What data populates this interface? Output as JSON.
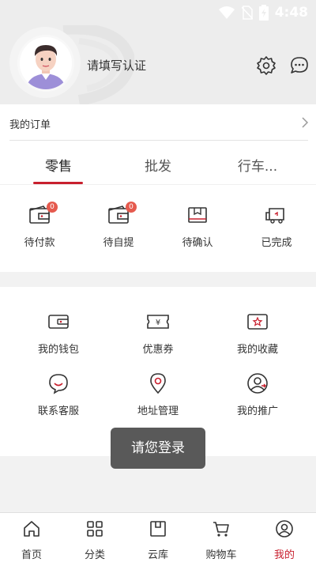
{
  "status_bar": {
    "time": "4:48"
  },
  "profile": {
    "name": "请填写认证"
  },
  "orders": {
    "title": "我的订单",
    "tabs": [
      {
        "label": "零售",
        "active": true
      },
      {
        "label": "批发",
        "active": false
      },
      {
        "label": "行车...",
        "active": false
      }
    ],
    "statuses": [
      {
        "label": "待付款",
        "badge": "0"
      },
      {
        "label": "待自提",
        "badge": "0"
      },
      {
        "label": "待确认"
      },
      {
        "label": "已完成"
      }
    ]
  },
  "services": [
    {
      "label": "我的钱包"
    },
    {
      "label": "优惠券"
    },
    {
      "label": "我的收藏"
    },
    {
      "label": "联系客服"
    },
    {
      "label": "地址管理"
    },
    {
      "label": "我的推广"
    }
  ],
  "toast": "请您登录",
  "tabbar": [
    {
      "label": "首页"
    },
    {
      "label": "分类"
    },
    {
      "label": "云库"
    },
    {
      "label": "购物车"
    },
    {
      "label": "我的",
      "active": true
    }
  ],
  "colors": {
    "accent": "#c8202e",
    "badge": "#e55a4e"
  }
}
